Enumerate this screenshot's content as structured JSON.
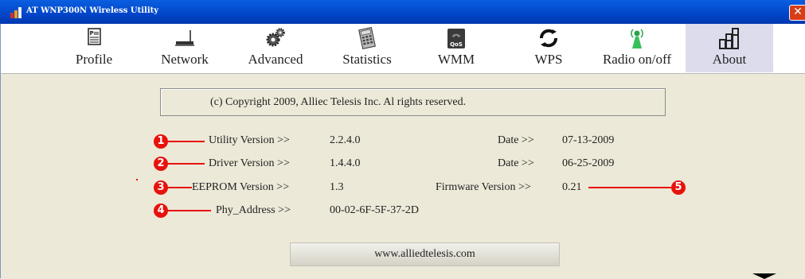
{
  "window": {
    "title": "AT WNP300N Wireless Utility",
    "close_glyph": "✕"
  },
  "toolbar": {
    "items": [
      {
        "label": "Profile",
        "icon": "profile-icon"
      },
      {
        "label": "Network",
        "icon": "router-icon"
      },
      {
        "label": "Advanced",
        "icon": "gears-icon"
      },
      {
        "label": "Statistics",
        "icon": "calculator-icon"
      },
      {
        "label": "WMM",
        "icon": "qos-icon"
      },
      {
        "label": "WPS",
        "icon": "wps-icon"
      },
      {
        "label": "Radio on/off",
        "icon": "antenna-icon"
      },
      {
        "label": "About",
        "icon": "about-icon",
        "active": true
      }
    ]
  },
  "about": {
    "copyright": "(c) Copyright 2009, Alliec Telesis Inc. Al rights reserved.",
    "utility_version_label": "Utility Version >>",
    "utility_version": "2.2.4.0",
    "utility_date_label": "Date >>",
    "utility_date": "07-13-2009",
    "driver_version_label": "Driver Version >>",
    "driver_version": "1.4.4.0",
    "driver_date_label": "Date >>",
    "driver_date": "06-25-2009",
    "eeprom_version_label": "EEPROM Version >>",
    "eeprom_version": "1.3",
    "firmware_version_label": "Firmware Version >>",
    "firmware_version": "0.21",
    "phy_address_label": "Phy_Address >>",
    "phy_address": "00-02-6F-5F-37-2D",
    "website": "www.alliedtelesis.com"
  },
  "callouts": [
    "1",
    "2",
    "3",
    "4",
    "5"
  ],
  "colors": {
    "callout": "#e8120c",
    "titlebar": "#0245c8",
    "background": "#ece9d8"
  }
}
